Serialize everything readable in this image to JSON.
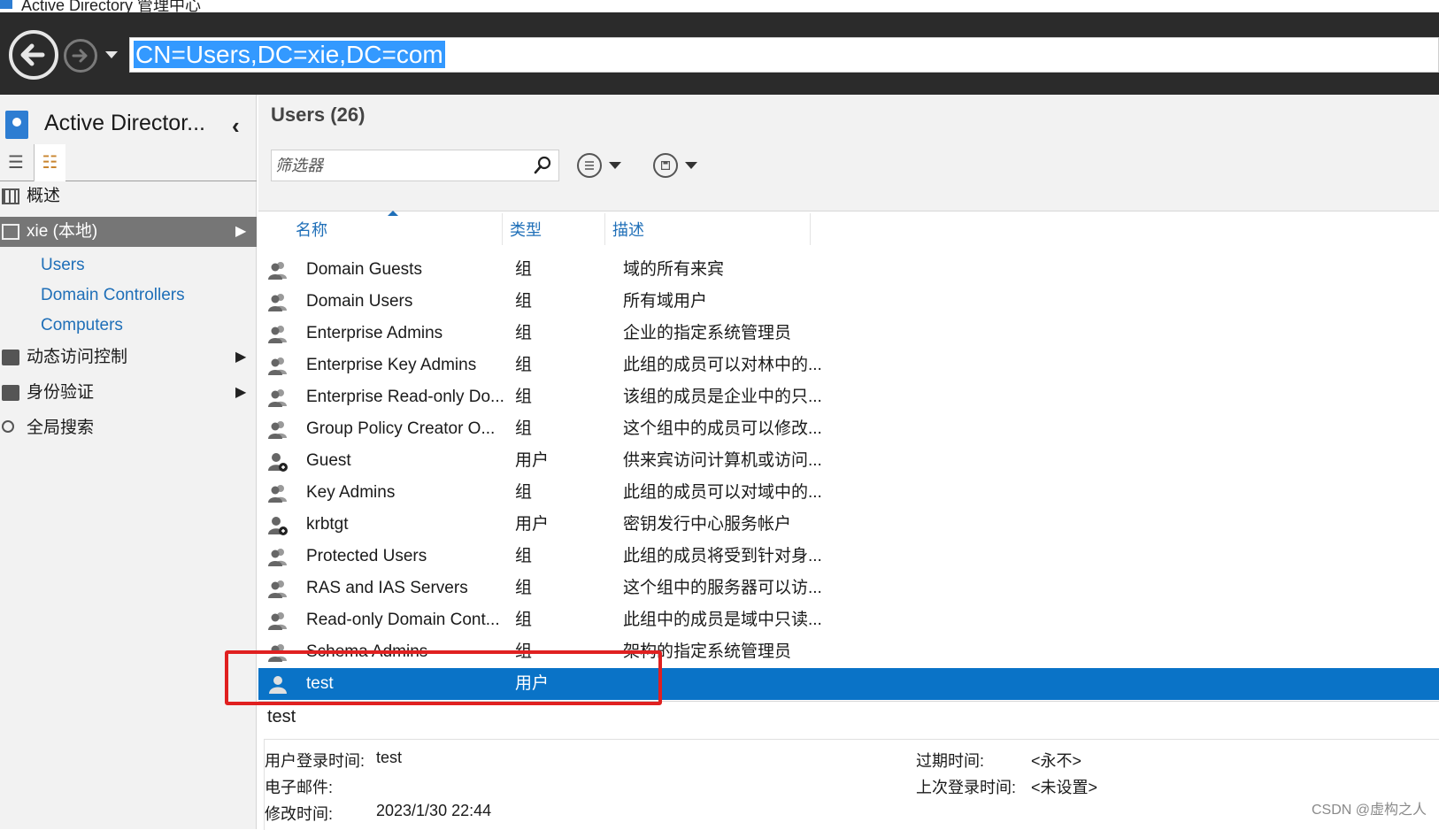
{
  "window": {
    "title": "Active Directory 管理中心"
  },
  "address": {
    "path": "CN=Users,DC=xie,DC=com"
  },
  "nav": {
    "title": "Active Director...",
    "collapse_glyph": "‹",
    "items": [
      {
        "label": "概述"
      },
      {
        "label": "xie (本地)"
      },
      {
        "label": "Users"
      },
      {
        "label": "Domain Controllers"
      },
      {
        "label": "Computers"
      },
      {
        "label": "动态访问控制"
      },
      {
        "label": "身份验证"
      },
      {
        "label": "全局搜索"
      }
    ]
  },
  "main": {
    "title": "Users  (26)",
    "filter_placeholder": "筛选器",
    "columns": {
      "name": "名称",
      "type": "类型",
      "desc": "描述"
    },
    "rows": [
      {
        "name": "Domain Guests",
        "type": "组",
        "desc": "域的所有来宾",
        "icon": "group-icon"
      },
      {
        "name": "Domain Users",
        "type": "组",
        "desc": "所有域用户",
        "icon": "group-icon"
      },
      {
        "name": "Enterprise Admins",
        "type": "组",
        "desc": "企业的指定系统管理员",
        "icon": "group-icon"
      },
      {
        "name": "Enterprise Key Admins",
        "type": "组",
        "desc": "此组的成员可以对林中的...",
        "icon": "group-icon"
      },
      {
        "name": "Enterprise Read-only Do...",
        "type": "组",
        "desc": "该组的成员是企业中的只...",
        "icon": "group-icon"
      },
      {
        "name": "Group Policy Creator O...",
        "type": "组",
        "desc": "这个组中的成员可以修改...",
        "icon": "group-icon"
      },
      {
        "name": "Guest",
        "type": "用户",
        "desc": "供来宾访问计算机或访问...",
        "icon": "disabled-user-icon"
      },
      {
        "name": "Key Admins",
        "type": "组",
        "desc": "此组的成员可以对域中的...",
        "icon": "group-icon"
      },
      {
        "name": "krbtgt",
        "type": "用户",
        "desc": "密钥发行中心服务帐户",
        "icon": "disabled-user-icon"
      },
      {
        "name": "Protected Users",
        "type": "组",
        "desc": "此组的成员将受到针对身...",
        "icon": "group-icon"
      },
      {
        "name": "RAS and IAS Servers",
        "type": "组",
        "desc": "这个组中的服务器可以访...",
        "icon": "group-icon"
      },
      {
        "name": "Read-only Domain Cont...",
        "type": "组",
        "desc": "此组中的成员是域中只读...",
        "icon": "group-icon"
      },
      {
        "name": "Schema Admins",
        "type": "组",
        "desc": "架构的指定系统管理员",
        "icon": "group-icon"
      },
      {
        "name": "test",
        "type": "用户",
        "desc": "",
        "icon": "user-icon"
      }
    ]
  },
  "details": {
    "title": "test",
    "fields": {
      "logon_label": "用户登录时间:",
      "logon_value": "test",
      "email_label": "电子邮件:",
      "email_value": "",
      "modified_label": "修改时间:",
      "modified_value": "2023/1/30 22:44",
      "expires_label": "过期时间:",
      "expires_value": "<永不>",
      "lastlogon_label": "上次登录时间:",
      "lastlogon_value": "<未设置>"
    }
  },
  "watermark": "CSDN @虚构之人",
  "colors": {
    "selected_row": "#0a73c7",
    "highlight_box": "#e02020",
    "link": "#1f6fb8"
  }
}
